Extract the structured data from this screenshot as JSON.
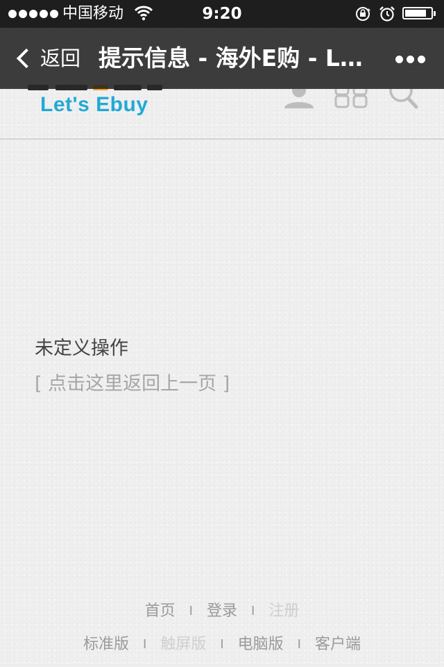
{
  "status_bar": {
    "carrier": "中国移动",
    "time": "9:20"
  },
  "nav_bar": {
    "back_label": "返回",
    "title": "提示信息 - 海外E购 - Let's Ebuy"
  },
  "site_header": {
    "logo_text": "Let's Ebuy",
    "icons": [
      "user-icon",
      "grid-icon",
      "search-icon"
    ]
  },
  "main": {
    "message": "未定义操作",
    "return_link": "[ 点击这里返回上一页 ]"
  },
  "footer": {
    "row1": {
      "home": "首页",
      "login": "登录",
      "register": "注册"
    },
    "row2": {
      "standard": "标准版",
      "touch": "触屏版",
      "desktop": "电脑版",
      "client": "客户端"
    },
    "separator": "I"
  },
  "colors": {
    "logo_blue": "#22a9d6",
    "link_gray": "#9a9a9a",
    "link_dim": "#cfcfcf",
    "nav_bg": "#282828"
  }
}
